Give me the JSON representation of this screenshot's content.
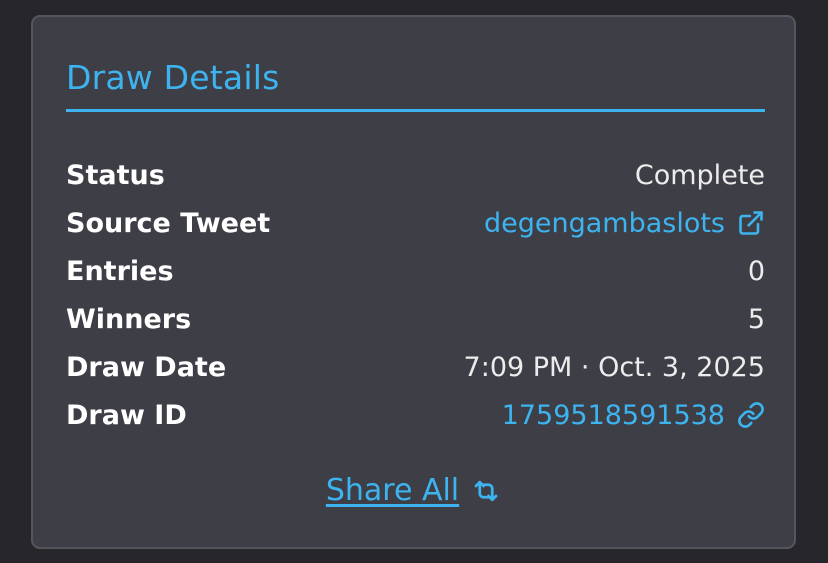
{
  "card": {
    "title": "Draw Details"
  },
  "details": {
    "status": {
      "label": "Status",
      "value": "Complete"
    },
    "source_tweet": {
      "label": "Source Tweet",
      "value": "degengambaslots",
      "icon": "external-link-icon"
    },
    "entries": {
      "label": "Entries",
      "value": "0"
    },
    "winners": {
      "label": "Winners",
      "value": "5"
    },
    "draw_date": {
      "label": "Draw Date",
      "value": "7:09 PM · Oct. 3, 2025"
    },
    "draw_id": {
      "label": "Draw ID",
      "value": "1759518591538",
      "icon": "link-icon"
    }
  },
  "share": {
    "label": "Share All",
    "icon": "repost-icon"
  },
  "colors": {
    "accent": "#3db4f0",
    "card_bg": "#3e3f46",
    "page_bg": "#27272b"
  }
}
